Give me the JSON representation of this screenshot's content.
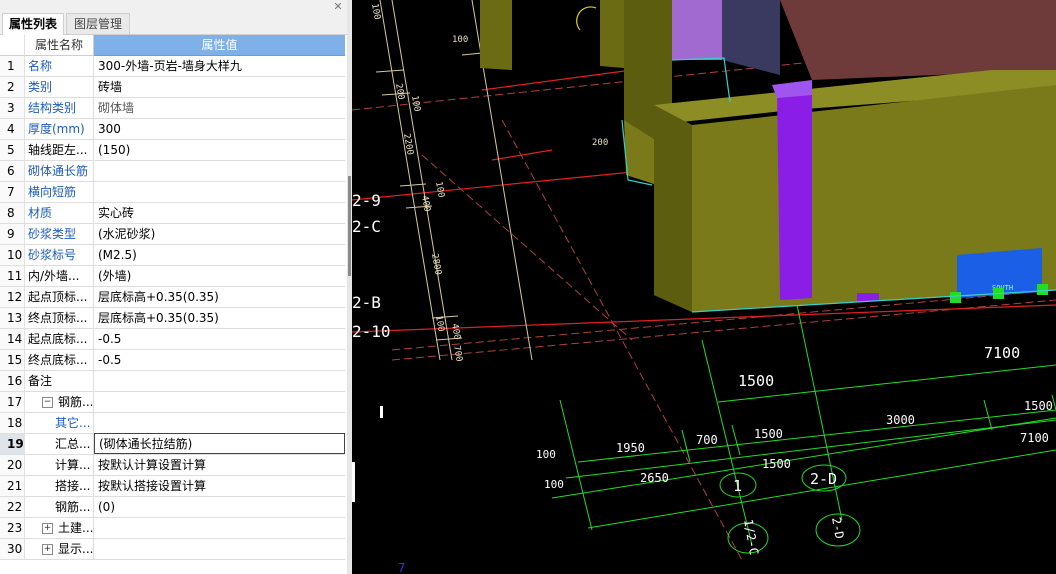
{
  "panel": {
    "tabs": [
      {
        "label": "属性列表",
        "active": true
      },
      {
        "label": "图层管理",
        "active": false
      }
    ],
    "close_icon": "close-icon",
    "header": {
      "name": "属性名称",
      "value": "属性值"
    },
    "rows": [
      {
        "num": "1",
        "name": "名称",
        "value": "300-外墙-页岩-墙身大样九",
        "blue": true
      },
      {
        "num": "2",
        "name": "类别",
        "value": "砖墙",
        "blue": true
      },
      {
        "num": "3",
        "name": "结构类别",
        "value": "砌体墙",
        "blue": true,
        "gray": true
      },
      {
        "num": "4",
        "name": "厚度(mm)",
        "value": "300",
        "blue": true
      },
      {
        "num": "5",
        "name": "轴线距左...",
        "value": "(150)"
      },
      {
        "num": "6",
        "name": "砌体通长筋",
        "value": "",
        "blue": true
      },
      {
        "num": "7",
        "name": "横向短筋",
        "value": "",
        "blue": true
      },
      {
        "num": "8",
        "name": "材质",
        "value": "实心砖",
        "blue": true
      },
      {
        "num": "9",
        "name": "砂浆类型",
        "value": "(水泥砂浆)",
        "blue": true
      },
      {
        "num": "10",
        "name": "砂浆标号",
        "value": "(M2.5)",
        "blue": true
      },
      {
        "num": "11",
        "name": "内/外墙...",
        "value": "(外墙)"
      },
      {
        "num": "12",
        "name": "起点顶标...",
        "value": "层底标高+0.35(0.35)"
      },
      {
        "num": "13",
        "name": "终点顶标...",
        "value": "层底标高+0.35(0.35)"
      },
      {
        "num": "14",
        "name": "起点底标...",
        "value": "-0.5"
      },
      {
        "num": "15",
        "name": "终点底标...",
        "value": "-0.5"
      },
      {
        "num": "16",
        "name": "备注",
        "value": ""
      },
      {
        "num": "17",
        "name": "钢筋...",
        "value": "",
        "expander": "−",
        "indent": 1
      },
      {
        "num": "18",
        "name": "其它...",
        "value": "",
        "indent": 2,
        "blue": true
      },
      {
        "num": "19",
        "name": "汇总...",
        "value": "(砌体通长拉结筋)",
        "indent": 2,
        "selected": true
      },
      {
        "num": "20",
        "name": "计算...",
        "value": "按默认计算设置计算",
        "indent": 2
      },
      {
        "num": "21",
        "name": "搭接...",
        "value": "按默认搭接设置计算",
        "indent": 2
      },
      {
        "num": "22",
        "name": "钢筋...",
        "value": "(0)",
        "indent": 2
      },
      {
        "num": "23",
        "name": "土建...",
        "value": "",
        "expander": "+",
        "indent": 1
      },
      {
        "num": "30",
        "name": "显示...",
        "value": "",
        "expander": "+",
        "indent": 1
      }
    ]
  },
  "canvas": {
    "axis_labels": [
      "2-9",
      "2-C",
      "2-B",
      "2-10"
    ],
    "axis_bubbles": [
      "1",
      "2-D",
      "1/2-C",
      "2-D"
    ],
    "dimensions": {
      "left_column": [
        "100",
        "200",
        "100",
        "2200",
        "100",
        "400",
        "2800",
        "100",
        "400",
        "700"
      ],
      "wall_200": "200",
      "big_7100_top": "7100",
      "big_1500": "1500",
      "row1": [
        "3000",
        "1500"
      ],
      "row2": [
        "1950",
        "700",
        "1500",
        "7100"
      ],
      "row3": [
        "2650",
        "1500"
      ],
      "left_100s": [
        "100",
        "100"
      ]
    },
    "bottom_mark": "7",
    "label_blue_box": "SOUTH",
    "colors": {
      "wall": "#7a7a1a",
      "wall_top": "#8d8d25",
      "purple": "#8a1ee6",
      "roof": "#6e3a3a",
      "blue_block": "#1a5fe6",
      "green": "#22dd22",
      "red": "#e02020",
      "cyan": "#36d0d0"
    }
  }
}
